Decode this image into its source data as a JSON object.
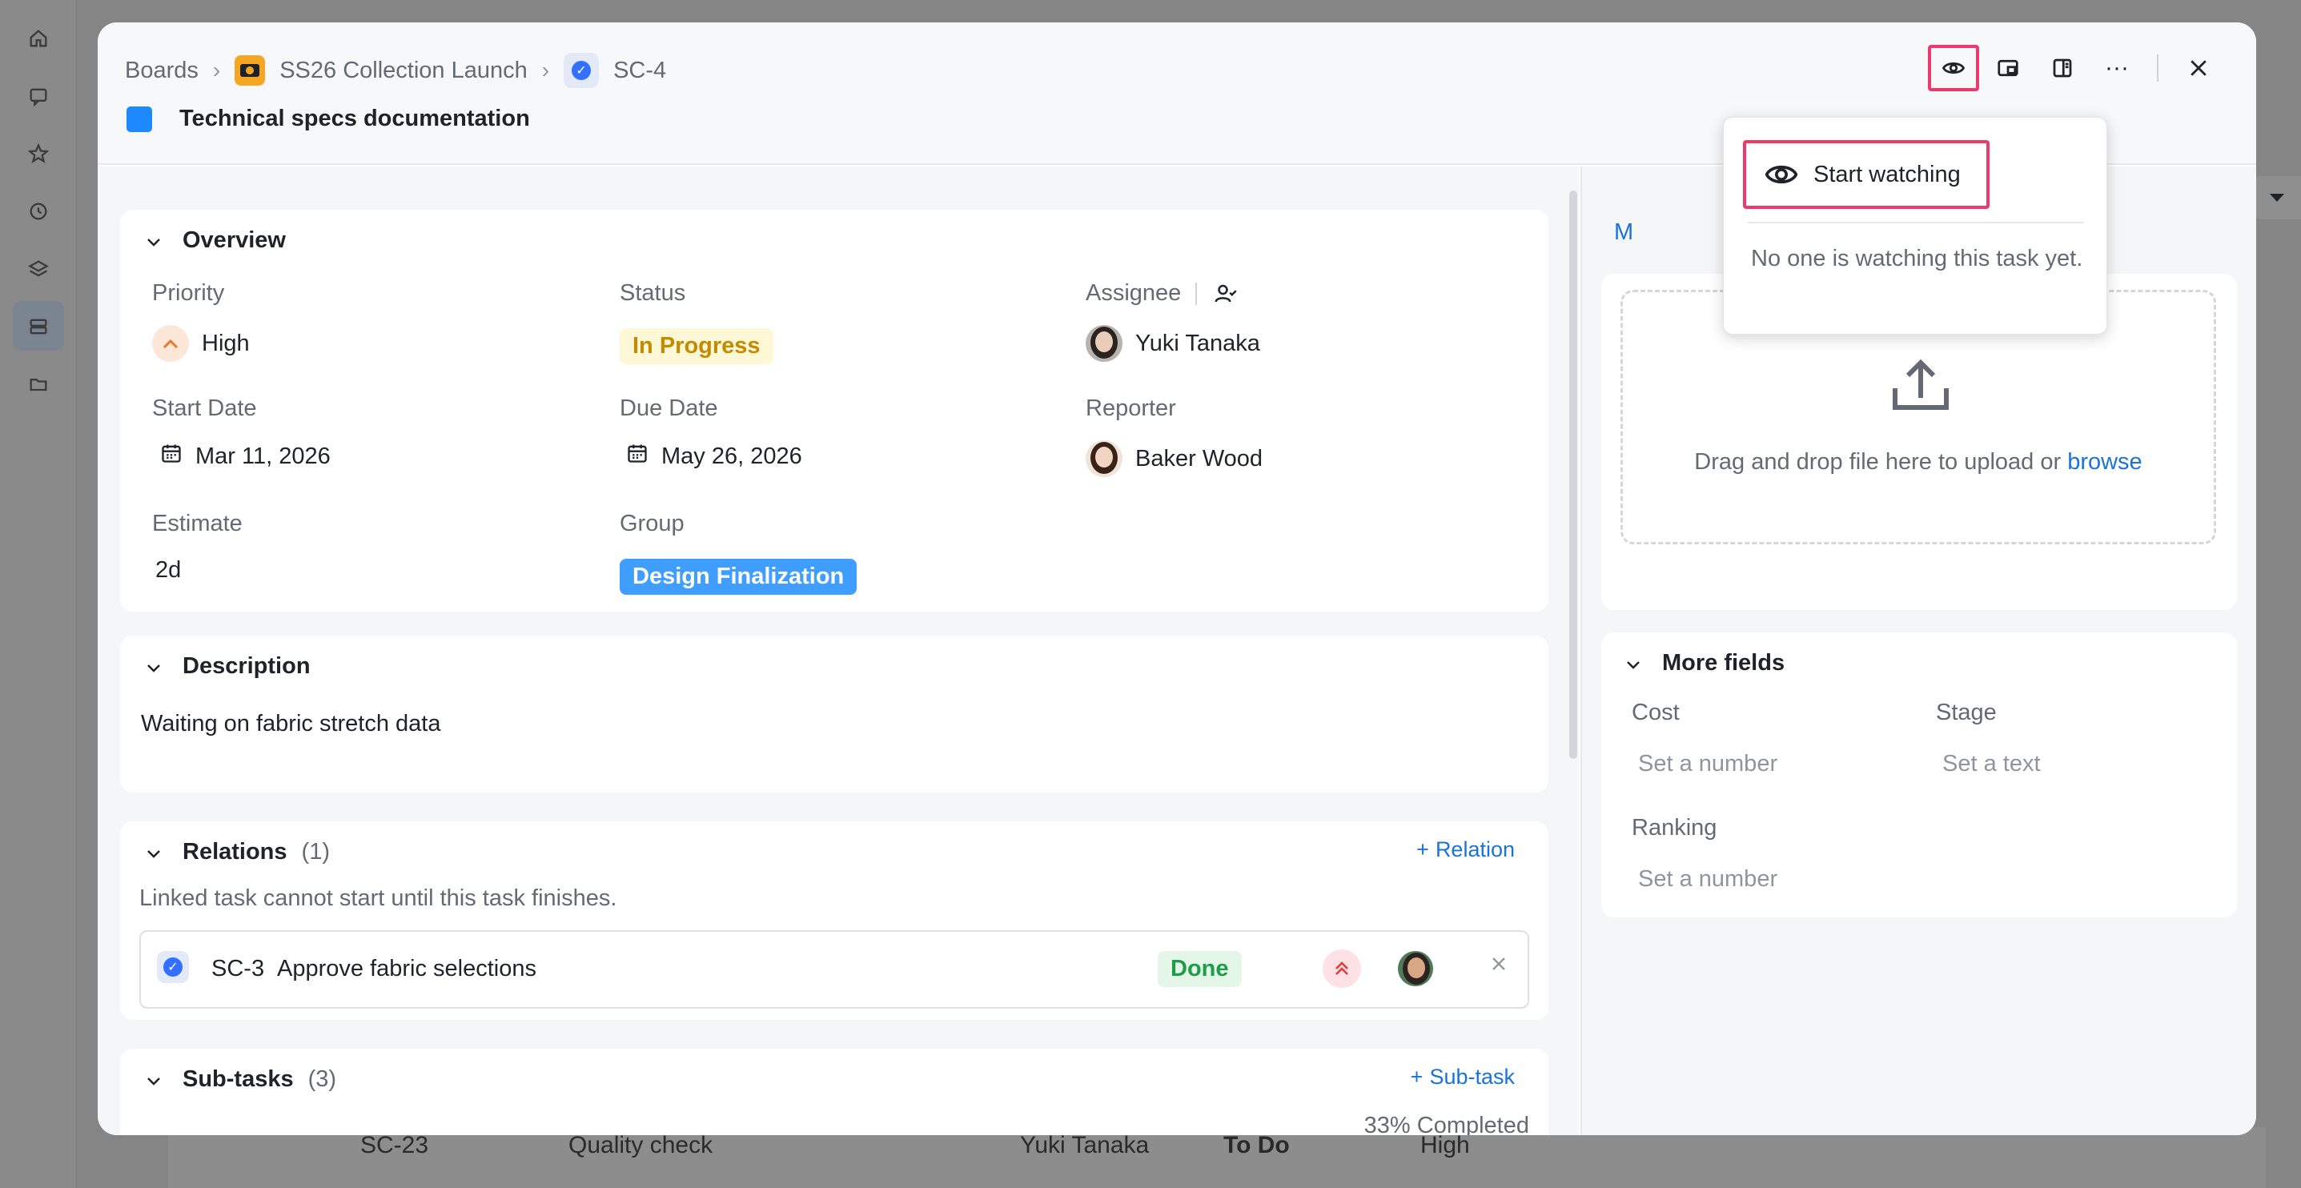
{
  "breadcrumb": {
    "boards": "Boards",
    "project": "SS26 Collection Launch",
    "task_id": "SC-4"
  },
  "task": {
    "title": "Technical specs documentation"
  },
  "overview": {
    "heading": "Overview",
    "priority_label": "Priority",
    "priority_value": "High",
    "status_label": "Status",
    "status_value": "In Progress",
    "assignee_label": "Assignee",
    "assignee_value": "Yuki Tanaka",
    "start_label": "Start Date",
    "start_value": "Mar 11, 2026",
    "due_label": "Due Date",
    "due_value": "May 26, 2026",
    "reporter_label": "Reporter",
    "reporter_value": "Baker Wood",
    "estimate_label": "Estimate",
    "estimate_value": "2d",
    "group_label": "Group",
    "group_value": "Design Finalization"
  },
  "description": {
    "heading": "Description",
    "text": "Waiting on fabric stretch data"
  },
  "relations": {
    "heading": "Relations",
    "count": "(1)",
    "add_label": "Relation",
    "note": "Linked task cannot start until this task finishes.",
    "item": {
      "id": "SC-3",
      "title": "Approve fabric selections",
      "status": "Done"
    }
  },
  "subtasks": {
    "heading": "Sub-tasks",
    "count": "(3)",
    "add_label": "Sub-task",
    "progress_text": "33% Completed",
    "progress": 0.33
  },
  "attachments": {
    "tab_partial": "M",
    "drop_text": "Drag and drop file here to upload or",
    "browse": "browse"
  },
  "more_fields": {
    "heading": "More fields",
    "cost_label": "Cost",
    "cost_placeholder": "Set a number",
    "stage_label": "Stage",
    "stage_placeholder": "Set a text",
    "ranking_label": "Ranking",
    "ranking_placeholder": "Set a number"
  },
  "watch_popover": {
    "action": "Start watching",
    "note": "No one is watching this task yet."
  },
  "background_row": {
    "id": "SC-23",
    "title": "Quality check",
    "assignee": "Yuki Tanaka",
    "status": "To Do",
    "priority": "High"
  },
  "colors": {
    "accent": "#1a73d9",
    "highlight": "#ee3a6a",
    "status_in_progress": "#c48a00",
    "group": "#3f9eff",
    "done": "#1f9c4a",
    "progress": "#1e88ff"
  }
}
